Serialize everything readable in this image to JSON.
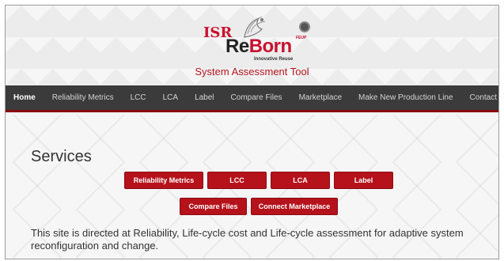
{
  "header": {
    "logo_isr": "ISR",
    "logo_re": "Re",
    "logo_born": "Born",
    "logo_tagline": "Innovative Reuse",
    "logo_feup": "FEUP",
    "site_title": "System Assessment Tool"
  },
  "nav": {
    "items": [
      {
        "label": "Home"
      },
      {
        "label": "Reliability Metrics"
      },
      {
        "label": "LCC"
      },
      {
        "label": "LCA"
      },
      {
        "label": "Label"
      },
      {
        "label": "Compare Files"
      },
      {
        "label": "Marketplace"
      },
      {
        "label": "Make New Production Line"
      },
      {
        "label": "Contact"
      }
    ]
  },
  "main": {
    "title": "Services",
    "buttons": [
      {
        "label": "Reliability Metrics"
      },
      {
        "label": "LCC"
      },
      {
        "label": "LCA"
      },
      {
        "label": "Label"
      },
      {
        "label": "Compare Files"
      },
      {
        "label": "Connect Marketplace"
      }
    ],
    "description": "This site is directed at Reliability, Life-cycle cost and Life-cycle assessment for adaptive system reconfiguration and change."
  },
  "colors": {
    "accent": "#b5121b",
    "nav_bg": "#3b3b3b",
    "nav_border": "#8a0a0a"
  }
}
